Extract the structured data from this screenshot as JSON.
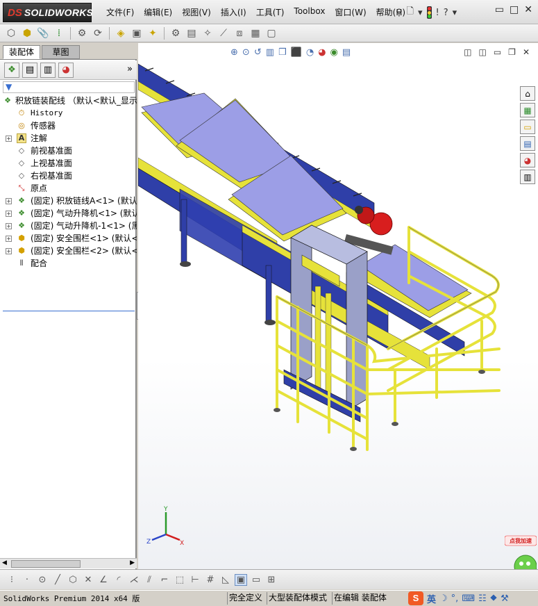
{
  "app": {
    "brand_prefix": "DS",
    "brand_name": "SOLIDWORKS"
  },
  "menu": [
    "文件(F)",
    "编辑(E)",
    "视图(V)",
    "插入(I)",
    "工具(T)",
    "Toolbox",
    "窗口(W)",
    "帮助(H)"
  ],
  "left_panel": {
    "tabs": [
      "装配体",
      "草图"
    ],
    "tree": [
      {
        "label": "积放链装配线 （默认<默认_显示",
        "icon": "assembly-icon",
        "expandable": false
      },
      {
        "label": "History",
        "icon": "history-icon",
        "expandable": false
      },
      {
        "label": "传感器",
        "icon": "sensor-icon",
        "expandable": false
      },
      {
        "label": "注解",
        "icon": "annotation-icon",
        "expandable": true
      },
      {
        "label": "前视基准面",
        "icon": "plane-icon",
        "expandable": false
      },
      {
        "label": "上视基准面",
        "icon": "plane-icon",
        "expandable": false
      },
      {
        "label": "右视基准面",
        "icon": "plane-icon",
        "expandable": false
      },
      {
        "label": "原点",
        "icon": "origin-icon",
        "expandable": false
      },
      {
        "label": "(固定) 积放链线A<1> (默认",
        "icon": "subassembly-icon",
        "expandable": true
      },
      {
        "label": "(固定) 气动升降机<1> (默认",
        "icon": "subassembly-icon",
        "expandable": true
      },
      {
        "label": "(固定) 气动升降机-1<1> (黑",
        "icon": "subassembly-icon",
        "expandable": true
      },
      {
        "label": "(固定) 安全围栏<1> (默认<",
        "icon": "part-icon",
        "expandable": true
      },
      {
        "label": "(固定) 安全围栏<2> (默认<",
        "icon": "part-icon",
        "expandable": true
      },
      {
        "label": "配合",
        "icon": "mates-icon",
        "expandable": false
      }
    ]
  },
  "status": {
    "product": "SolidWorks Premium 2014 x64 版",
    "fully_defined": "完全定义",
    "mode": "大型装配体模式",
    "editing": "在编辑 装配体",
    "ime_lang": "英"
  },
  "speedup_badge": "点我加速",
  "triad": {
    "x": "X",
    "y": "Y",
    "z": "Z"
  },
  "colors": {
    "plate": "#9c9ee6",
    "frame": "#2f3fa8",
    "rail": "#e6e23a",
    "motor": "#d81e1e",
    "selection": "#3a6fd0"
  }
}
